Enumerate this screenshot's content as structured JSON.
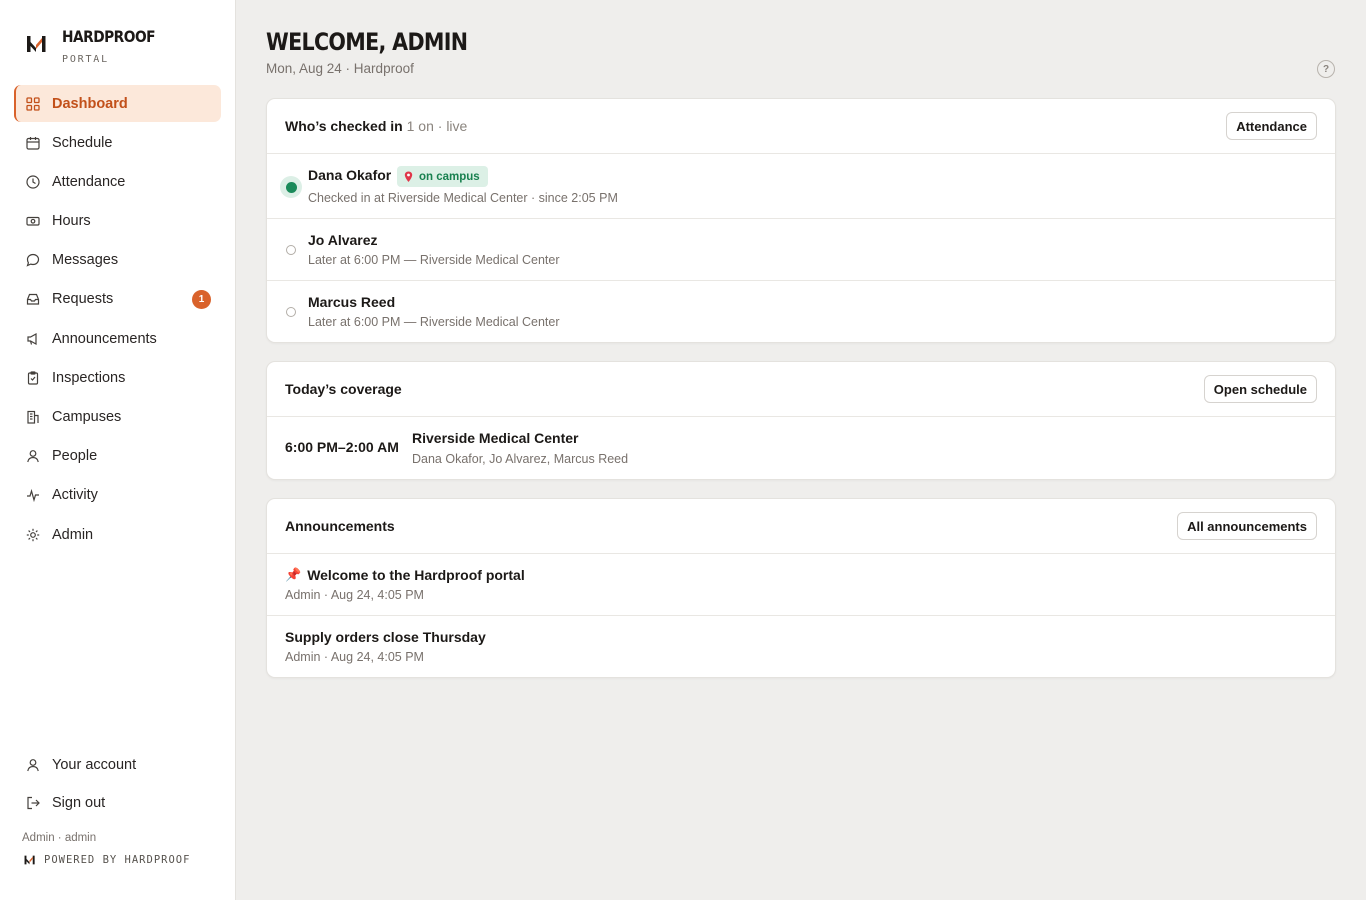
{
  "brand": {
    "name": "HARDPROOF",
    "sub": "PORTAL",
    "accent": "#d9622b"
  },
  "sidebar": {
    "items": [
      {
        "label": "Dashboard",
        "icon": "grid-icon",
        "active": true
      },
      {
        "label": "Schedule",
        "icon": "calendar-icon"
      },
      {
        "label": "Attendance",
        "icon": "clock-icon"
      },
      {
        "label": "Hours",
        "icon": "cash-icon"
      },
      {
        "label": "Messages",
        "icon": "chat-bubble-icon"
      },
      {
        "label": "Requests",
        "icon": "inbox-icon",
        "badge": "1"
      },
      {
        "label": "Announcements",
        "icon": "megaphone-icon"
      },
      {
        "label": "Inspections",
        "icon": "clipboard-check-icon"
      },
      {
        "label": "Campuses",
        "icon": "building-icon"
      },
      {
        "label": "People",
        "icon": "person-icon"
      },
      {
        "label": "Activity",
        "icon": "activity-pulse-icon"
      },
      {
        "label": "Admin",
        "icon": "sun-gear-icon"
      }
    ],
    "bottom": [
      {
        "label": "Your account",
        "icon": "person-icon"
      },
      {
        "label": "Sign out",
        "icon": "sign-out-icon"
      }
    ],
    "user_line": "Admin · admin",
    "powered_by": "POWERED BY HARDPROOF"
  },
  "header": {
    "title": "WELCOME, ADMIN",
    "subtitle": "Mon, Aug 24 · Hardproof",
    "help": "?"
  },
  "checked_in": {
    "title": "Who’s checked in",
    "summary": "1 on · live",
    "button": "Attendance",
    "people": [
      {
        "name": "Dana Okafor",
        "status": "on",
        "badge": "on campus",
        "detail": "Checked in at Riverside Medical Center · since 2:05 PM"
      },
      {
        "name": "Jo Alvarez",
        "status": "off",
        "detail": "Later at 6:00 PM — Riverside Medical Center"
      },
      {
        "name": "Marcus Reed",
        "status": "off",
        "detail": "Later at 6:00 PM — Riverside Medical Center"
      }
    ]
  },
  "coverage": {
    "title": "Today’s coverage",
    "button": "Open schedule",
    "shifts": [
      {
        "time": "6:00 PM–2:00 AM",
        "site": "Riverside Medical Center",
        "people": "Dana Okafor, Jo Alvarez, Marcus Reed"
      }
    ]
  },
  "announcements": {
    "title": "Announcements",
    "button": "All announcements",
    "items": [
      {
        "title": "Welcome to the Hardproof portal",
        "pinned": true,
        "meta": "Admin · Aug 24, 4:05 PM"
      },
      {
        "title": "Supply orders close Thursday",
        "pinned": false,
        "meta": "Admin · Aug 24, 4:05 PM"
      }
    ]
  }
}
